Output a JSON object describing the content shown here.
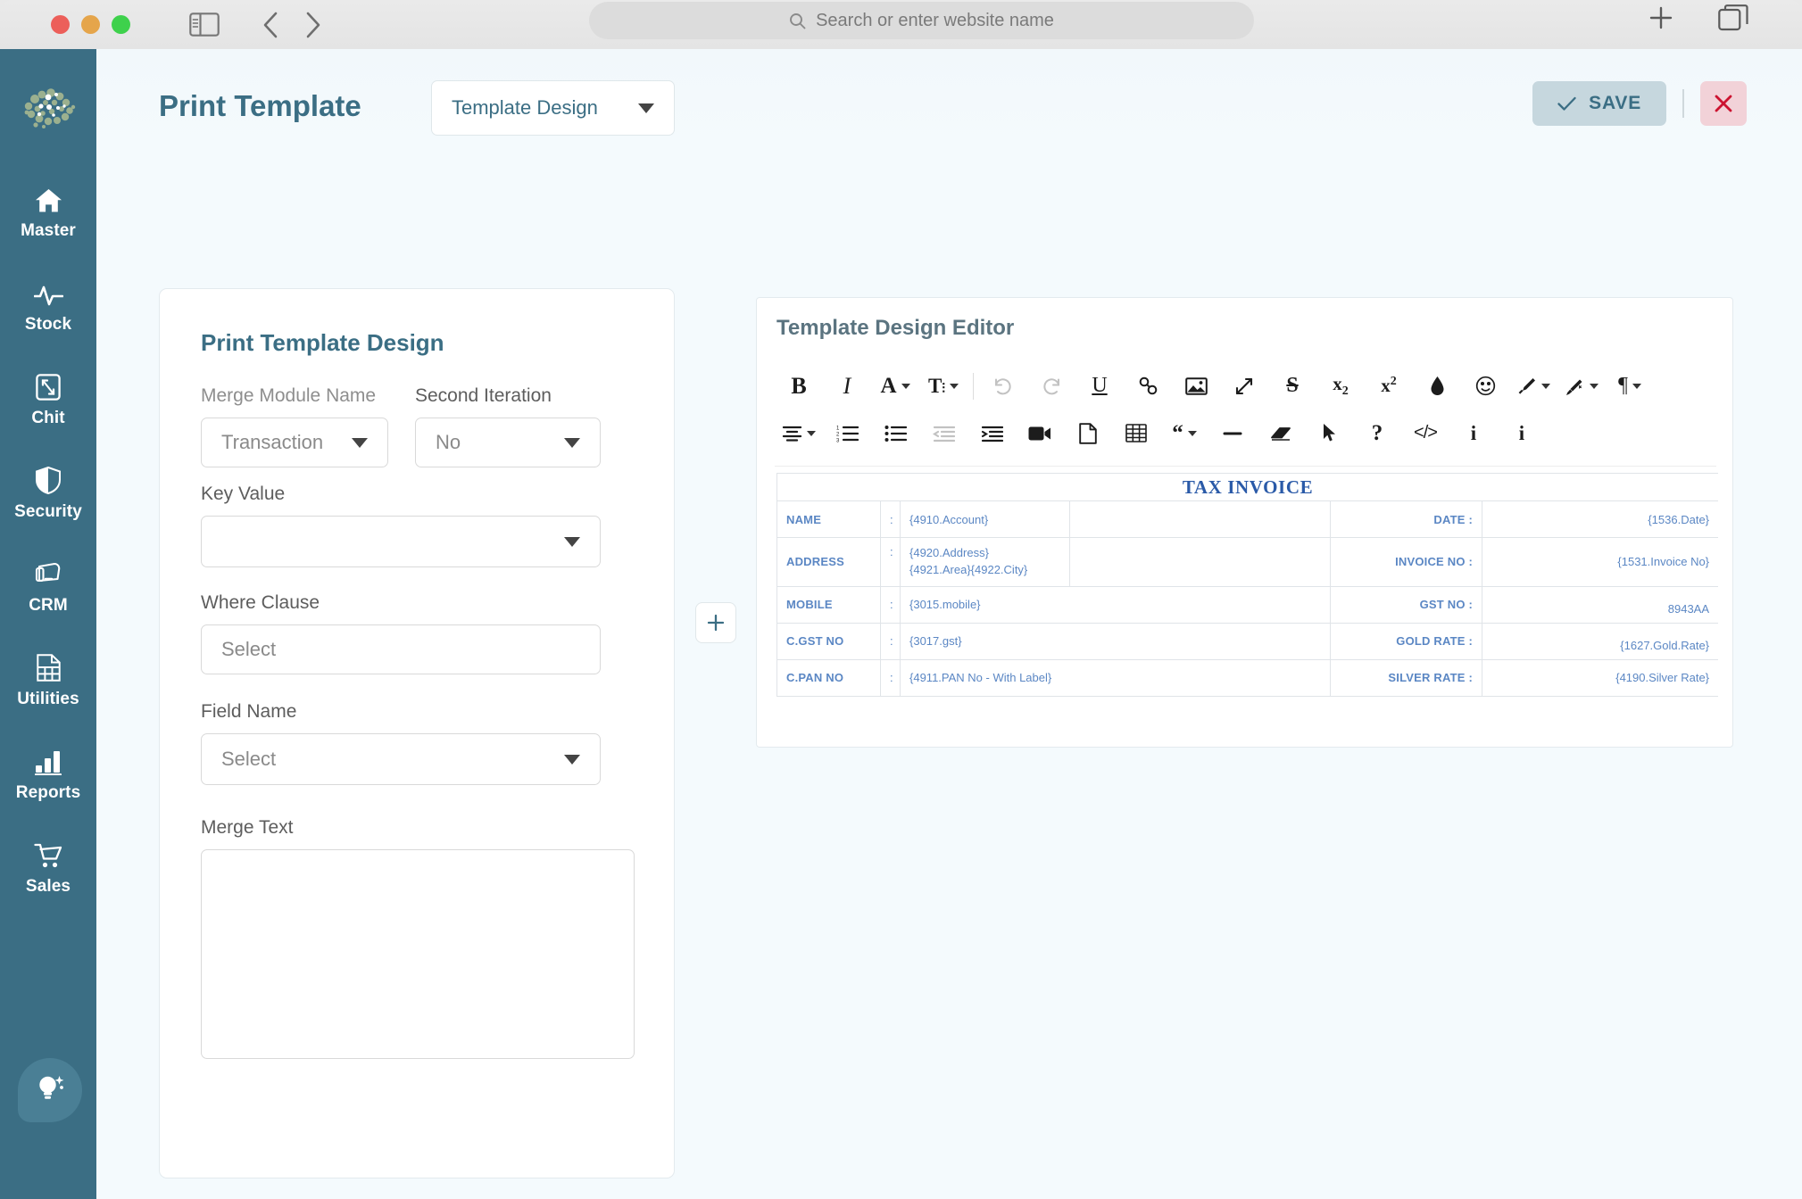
{
  "browser": {
    "traffic_lights": [
      "close",
      "minimize",
      "zoom"
    ],
    "sidebar_toggle_icon": "sidebar-toggle-icon",
    "back_icon": "chevron-left-icon",
    "forward_icon": "chevron-right-icon",
    "search": {
      "placeholder": "Search or enter website name",
      "icon": "search-icon"
    },
    "new_tab_icon": "plus-icon",
    "tab_overview_icon": "tabs-icon"
  },
  "sidebar": {
    "logo_name": "brain-logo",
    "items": [
      {
        "label": "Master",
        "icon": "home-icon"
      },
      {
        "label": "Stock",
        "icon": "pulse-icon"
      },
      {
        "label": "Chit",
        "icon": "expand-frame-icon"
      },
      {
        "label": "Security",
        "icon": "shield-icon"
      },
      {
        "label": "CRM",
        "icon": "contact-card-icon"
      },
      {
        "label": "Utilities",
        "icon": "document-grid-icon"
      },
      {
        "label": "Reports",
        "icon": "bar-chart-icon"
      },
      {
        "label": "Sales",
        "icon": "shopping-cart-icon"
      }
    ],
    "assistant_icon": "lightbulb-icon"
  },
  "header": {
    "title": "Print Template",
    "module_select": {
      "value": "Template Design"
    },
    "save_label": "SAVE",
    "save_icon": "check-icon",
    "close_icon": "close-x-icon"
  },
  "form": {
    "card_title": "Print Template Design",
    "fields": [
      {
        "label": "Merge Module Name",
        "value": "Transaction",
        "placeholder": "",
        "type": "select",
        "muted_label": true
      },
      {
        "label": "Second Iteration",
        "value": "No",
        "placeholder": "",
        "type": "select",
        "muted_label": false
      },
      {
        "label": "Key Value",
        "value": "",
        "placeholder": "",
        "type": "select",
        "muted_label": false
      },
      {
        "label": "Where Clause",
        "value": "",
        "placeholder": "Select",
        "type": "text",
        "muted_label": false
      },
      {
        "label": "Field Name",
        "value": "",
        "placeholder": "Select",
        "type": "select",
        "muted_label": false
      },
      {
        "label": "Merge Text",
        "value": "",
        "placeholder": "",
        "type": "textarea",
        "muted_label": false
      }
    ],
    "add_row_icon": "plus-icon"
  },
  "editor": {
    "title": "Template Design Editor",
    "toolbar_row1": [
      {
        "name": "bold-icon",
        "glyph": "B",
        "style": "bold-serif",
        "dropdown": false,
        "muted": false
      },
      {
        "name": "italic-icon",
        "glyph": "I",
        "style": "italic-serif",
        "dropdown": false,
        "muted": false
      },
      {
        "name": "font-family-icon",
        "glyph": "A",
        "style": "bold-serif",
        "dropdown": true,
        "muted": false
      },
      {
        "name": "font-size-icon",
        "glyph": "T!",
        "style": "bold-serif-sm",
        "dropdown": true,
        "muted": false
      },
      {
        "name": "separator",
        "glyph": "",
        "style": "sep",
        "dropdown": false,
        "muted": false
      },
      {
        "name": "undo-icon",
        "glyph": "↺",
        "style": "plain",
        "dropdown": false,
        "muted": true
      },
      {
        "name": "redo-icon",
        "glyph": "↻",
        "style": "plain",
        "dropdown": false,
        "muted": true
      },
      {
        "name": "underline-icon",
        "glyph": "U",
        "style": "underline",
        "dropdown": false,
        "muted": false
      },
      {
        "name": "link-icon",
        "glyph": "🔗",
        "style": "plain",
        "dropdown": false,
        "muted": false
      },
      {
        "name": "insert-image-icon",
        "glyph": "🖼",
        "style": "plain",
        "dropdown": false,
        "muted": false
      },
      {
        "name": "fullscreen-icon",
        "glyph": "⤢",
        "style": "plain",
        "dropdown": false,
        "muted": false
      },
      {
        "name": "strikethrough-icon",
        "glyph": "S",
        "style": "strike",
        "dropdown": false,
        "muted": false
      },
      {
        "name": "subscript-icon",
        "glyph": "x₂",
        "style": "plain",
        "dropdown": false,
        "muted": false
      },
      {
        "name": "superscript-icon",
        "glyph": "x²",
        "style": "plain",
        "dropdown": false,
        "muted": false
      },
      {
        "name": "text-color-icon",
        "glyph": "💧",
        "style": "plain",
        "dropdown": false,
        "muted": false
      },
      {
        "name": "emoticon-icon",
        "glyph": "☺",
        "style": "plain",
        "dropdown": false,
        "muted": false
      },
      {
        "name": "paint-format-icon",
        "glyph": "🖌",
        "style": "plain",
        "dropdown": true,
        "muted": false
      },
      {
        "name": "clear-formatting-icon",
        "glyph": "🪄",
        "style": "plain",
        "dropdown": true,
        "muted": false
      },
      {
        "name": "paragraph-format-icon",
        "glyph": "¶",
        "style": "plain",
        "dropdown": true,
        "muted": false
      }
    ],
    "toolbar_row2": [
      {
        "name": "align-icon",
        "glyph": "≡",
        "style": "align",
        "dropdown": true,
        "muted": false
      },
      {
        "name": "ordered-list-icon",
        "glyph": "≔",
        "style": "olist",
        "dropdown": false,
        "muted": false
      },
      {
        "name": "unordered-list-icon",
        "glyph": "☰",
        "style": "ulist",
        "dropdown": false,
        "muted": false
      },
      {
        "name": "outdent-icon",
        "glyph": "⇤",
        "style": "indent",
        "dropdown": false,
        "muted": true
      },
      {
        "name": "indent-icon",
        "glyph": "⇥",
        "style": "indent",
        "dropdown": false,
        "muted": false
      },
      {
        "name": "insert-video-icon",
        "glyph": "🎥",
        "style": "plain",
        "dropdown": false,
        "muted": false
      },
      {
        "name": "insert-file-icon",
        "glyph": "📄",
        "style": "plain",
        "dropdown": false,
        "muted": false
      },
      {
        "name": "insert-table-icon",
        "glyph": "▦",
        "style": "plain",
        "dropdown": false,
        "muted": false
      },
      {
        "name": "quote-icon",
        "glyph": "❝",
        "style": "quote",
        "dropdown": true,
        "muted": false
      },
      {
        "name": "horizontal-line-icon",
        "glyph": "—",
        "style": "plain",
        "dropdown": false,
        "muted": false
      },
      {
        "name": "eraser-icon",
        "glyph": "◣",
        "style": "plain",
        "dropdown": false,
        "muted": false
      },
      {
        "name": "select-all-icon",
        "glyph": "➤",
        "style": "plain",
        "dropdown": false,
        "muted": false
      },
      {
        "name": "help-icon",
        "glyph": "?",
        "style": "bold-serif",
        "dropdown": false,
        "muted": false
      },
      {
        "name": "code-view-icon",
        "glyph": "</>",
        "style": "plain-sm",
        "dropdown": false,
        "muted": false
      },
      {
        "name": "info-icon",
        "glyph": "i",
        "style": "bold-serif",
        "dropdown": false,
        "muted": false
      },
      {
        "name": "about-icon",
        "glyph": "i",
        "style": "bold-serif",
        "dropdown": false,
        "muted": false
      }
    ],
    "document": {
      "title": "TAX INVOICE",
      "left_rows": [
        {
          "label": "NAME",
          "value": "{4910.Account}"
        },
        {
          "label": "ADDRESS",
          "value": "{4920.Address}\n{4921.Area}{4922.City}"
        },
        {
          "label": "MOBILE",
          "value": "{3015.mobile}"
        },
        {
          "label": "C.GST NO",
          "value": "{3017.gst}"
        },
        {
          "label": "C.PAN NO",
          "value": "{4911.PAN No - With Label}"
        }
      ],
      "right_rows": [
        {
          "label": "DATE :",
          "value": "{1536.Date}"
        },
        {
          "label": "INVOICE NO :",
          "value": "{1531.Invoice No}"
        },
        {
          "label": "GST NO :",
          "value": "8943AA"
        },
        {
          "label": "GOLD RATE :",
          "value": "{1627.Gold.Rate}"
        },
        {
          "label": "SILVER RATE :",
          "value": "{4190.Silver Rate}"
        }
      ]
    }
  },
  "colors": {
    "sidebar_bg": "#3b6e84",
    "accent": "#3b6e84",
    "page_bg": "#f4fafd",
    "invoice_text": "#5b87c4",
    "invoice_title": "#2a5aa8",
    "save_bg": "#c6d7de",
    "close_bg": "#f2d2d8",
    "close_fg": "#cc1330"
  }
}
